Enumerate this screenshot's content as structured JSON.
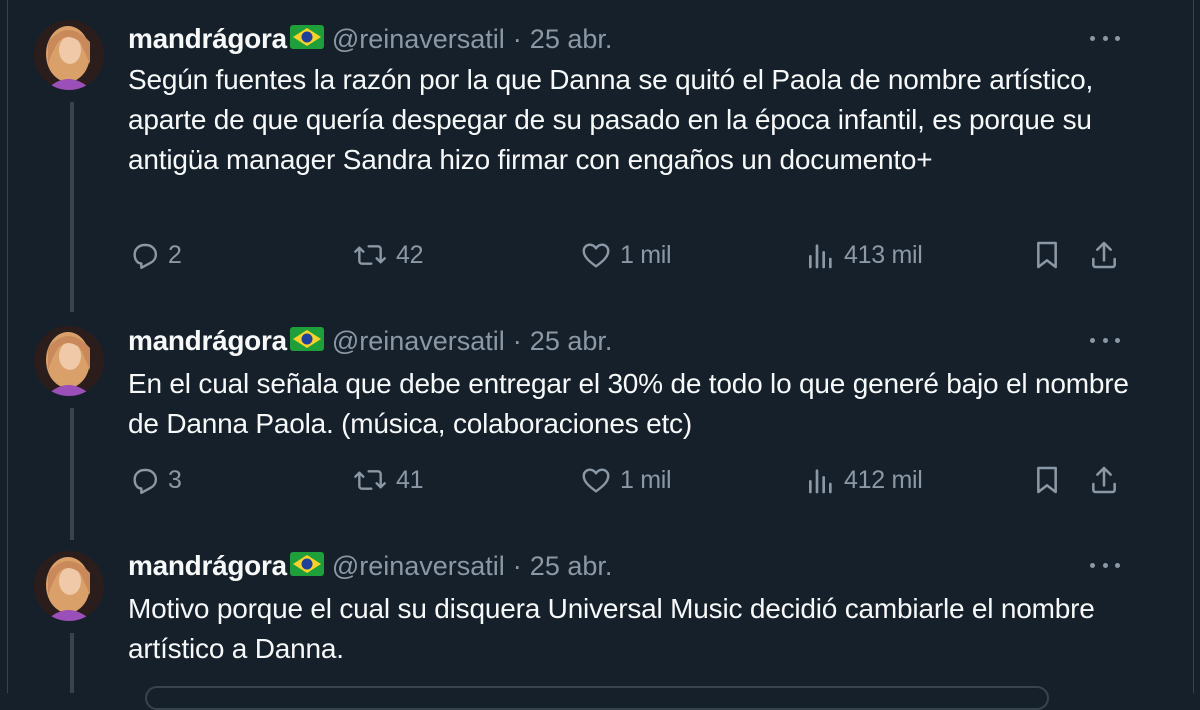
{
  "tweets": [
    {
      "name": "mandrágora",
      "handle": "@reinaversatil",
      "separator": "·",
      "date": "25 abr.",
      "text": "Según fuentes la razón por la que Danna se quitó el Paola de nombre artístico, aparte de que quería despegar de su pasado en la época infantil, es porque su antigüa manager Sandra hizo firmar con engaños un documento+",
      "replies": "2",
      "retweets": "42",
      "likes": "1 mil",
      "views": "413 mil"
    },
    {
      "name": "mandrágora",
      "handle": "@reinaversatil",
      "separator": "·",
      "date": "25 abr.",
      "text": "En el cual señala que debe entregar el 30% de todo lo que generé bajo el nombre de Danna Paola. (música, colaboraciones etc)",
      "replies": "3",
      "retweets": "41",
      "likes": "1 mil",
      "views": "412 mil"
    },
    {
      "name": "mandrágora",
      "handle": "@reinaversatil",
      "separator": "·",
      "date": "25 abr.",
      "text": "Motivo porque el cual su disquera Universal Music decidió cambiarle el nombre artístico a Danna."
    }
  ],
  "icons": {
    "reply": "reply-icon",
    "retweet": "retweet-icon",
    "like": "heart-icon",
    "views": "views-icon",
    "bookmark": "bookmark-icon",
    "share": "share-icon",
    "more": "more-icon",
    "flag": "brazil-flag-icon"
  },
  "colors": {
    "background": "#15202b",
    "text": "#f7f9f9",
    "muted": "#8b98a5",
    "border": "#38444d"
  }
}
